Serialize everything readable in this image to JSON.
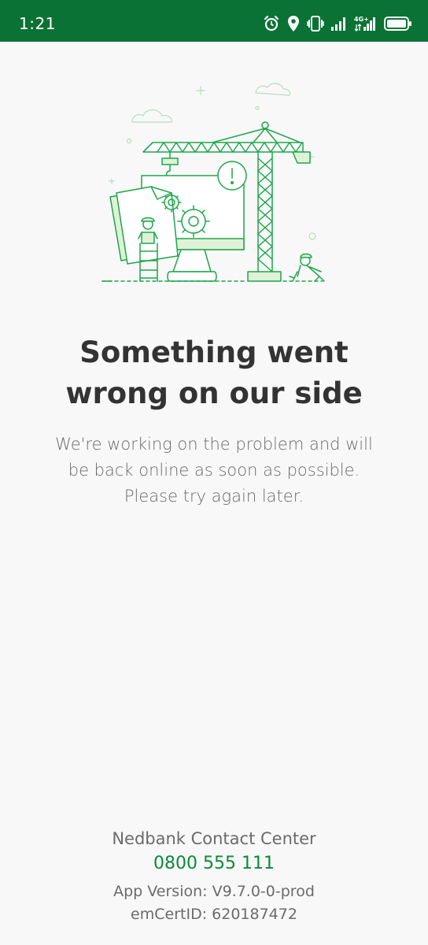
{
  "status_bar": {
    "time": "1:21",
    "icons": [
      "alarm-icon",
      "location-icon",
      "vibrate-icon",
      "signal-icon",
      "lte-signal-icon",
      "battery-icon"
    ],
    "network_label": "4G+",
    "background": "#0a7234"
  },
  "error": {
    "illustration": "construction-crane-illustration",
    "title_line1": "Something went",
    "title_line2": "wrong on our side",
    "message_line1": "We're working on the problem and will",
    "message_line2": "be back online as soon as possible.",
    "message_line3": "Please try again later."
  },
  "footer": {
    "contact_label": "Nedbank Contact Center",
    "contact_number": "0800 555 111",
    "app_version": "App Version: V9.7.0-0-prod",
    "cert_id": "emCertID: 620187472"
  },
  "colors": {
    "accent": "#0a8a3a",
    "illustration_green": "#1ea64b",
    "illustration_fill": "#dff2d8",
    "title": "#333333",
    "body_text": "#6b6b6b"
  }
}
